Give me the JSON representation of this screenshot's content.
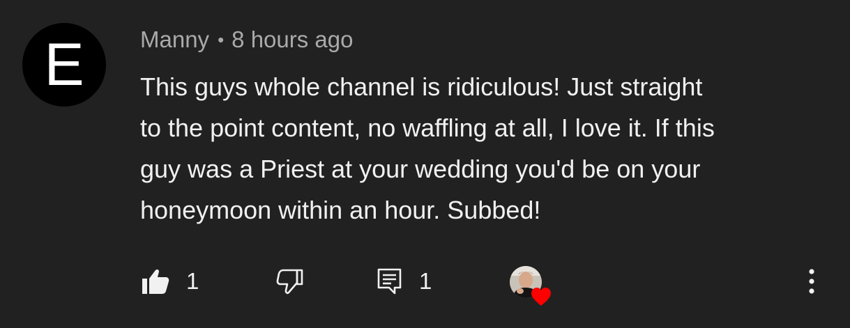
{
  "comment": {
    "avatar_letter": "E",
    "author": "Manny",
    "separator": "•",
    "timestamp": "8 hours ago",
    "text_lines": [
      "This guys whole channel is ridiculous! Just straight",
      "to the point content, no waffling at all, I love it. If this",
      "guy was a Priest at your wedding you'd be on your",
      "honeymoon within an hour. Subbed!"
    ]
  },
  "actions": {
    "like_icon": "thumbs-up-filled-icon",
    "like_count": "1",
    "dislike_icon": "thumbs-down-outline-icon",
    "reply_icon": "reply-comment-icon",
    "reply_count": "1",
    "creator_heart_icon": "heart-icon",
    "more_icon": "more-vertical-icon"
  },
  "colors": {
    "background": "#212121",
    "text": "#f1f1f1",
    "meta": "#aaaaaa",
    "heart": "#ff0000"
  }
}
